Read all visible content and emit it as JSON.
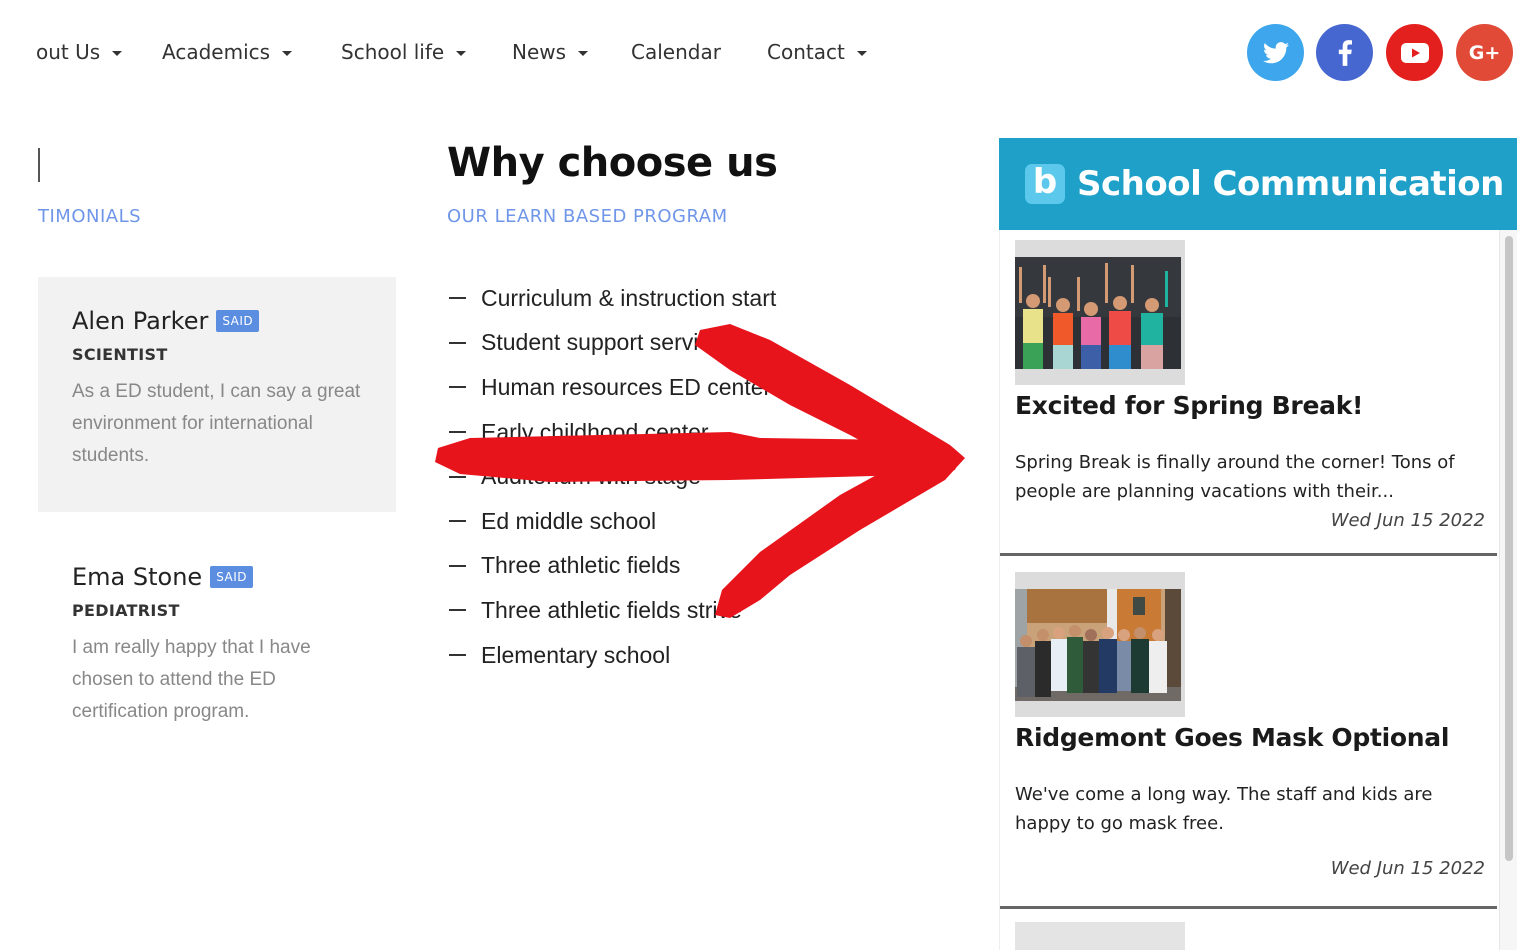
{
  "nav": {
    "items": [
      {
        "label": "out Us",
        "has_dropdown": true
      },
      {
        "label": "Academics",
        "has_dropdown": true
      },
      {
        "label": "School life",
        "has_dropdown": true
      },
      {
        "label": "News",
        "has_dropdown": true
      },
      {
        "label": "Calendar",
        "has_dropdown": false
      },
      {
        "label": "Contact",
        "has_dropdown": true
      }
    ],
    "social": [
      {
        "name": "twitter",
        "icon": "twitter-icon",
        "color": "#3ea6ec"
      },
      {
        "name": "facebook",
        "icon": "facebook-icon",
        "color": "#4667d0"
      },
      {
        "name": "youtube",
        "icon": "youtube-icon",
        "color": "#e3201e"
      },
      {
        "name": "google-plus",
        "icon": "google-plus-icon",
        "glyph": "G+",
        "color": "#e04a37"
      }
    ]
  },
  "testimonials": {
    "section_label": "TIMONIALS",
    "badge": "SAID",
    "items": [
      {
        "name": "Alen Parker",
        "role": "SCIENTIST",
        "quote": "As a ED student, I can say a great environment for international students."
      },
      {
        "name": "Ema Stone",
        "role": "PEDIATRIST",
        "quote": "I am really happy that I have chosen to attend the ED certification program."
      }
    ]
  },
  "why_choose": {
    "title": "Why choose us",
    "subtitle": "OUR LEARN BASED PROGRAM",
    "features": [
      "Curriculum & instruction start",
      "Student support services",
      "Human resources ED center",
      "Early childhood center",
      "Auditorium with stage",
      "Ed middle school",
      "Three athletic fields",
      "Three athletic fields strive",
      "Elementary school"
    ]
  },
  "annotation": {
    "type": "red-arrow",
    "color": "#e8141c",
    "points_to": "School Communication panel"
  },
  "school_communication": {
    "logo_letter": "b",
    "title": "School Communication",
    "header_color": "#1ea0c9",
    "posts": [
      {
        "title": "Excited for Spring Break!",
        "excerpt": "Spring Break is finally around the corner! Tons of people are planning vacations with their...",
        "date": "Wed Jun 15 2022",
        "image": "children cheering in front of chalkboard"
      },
      {
        "title": "Ridgemont Goes Mask Optional",
        "excerpt": "We've come a long way. The staff and kids are happy to go mask free.",
        "date": "Wed Jun 15 2022",
        "image": "group of students in classroom"
      }
    ]
  }
}
